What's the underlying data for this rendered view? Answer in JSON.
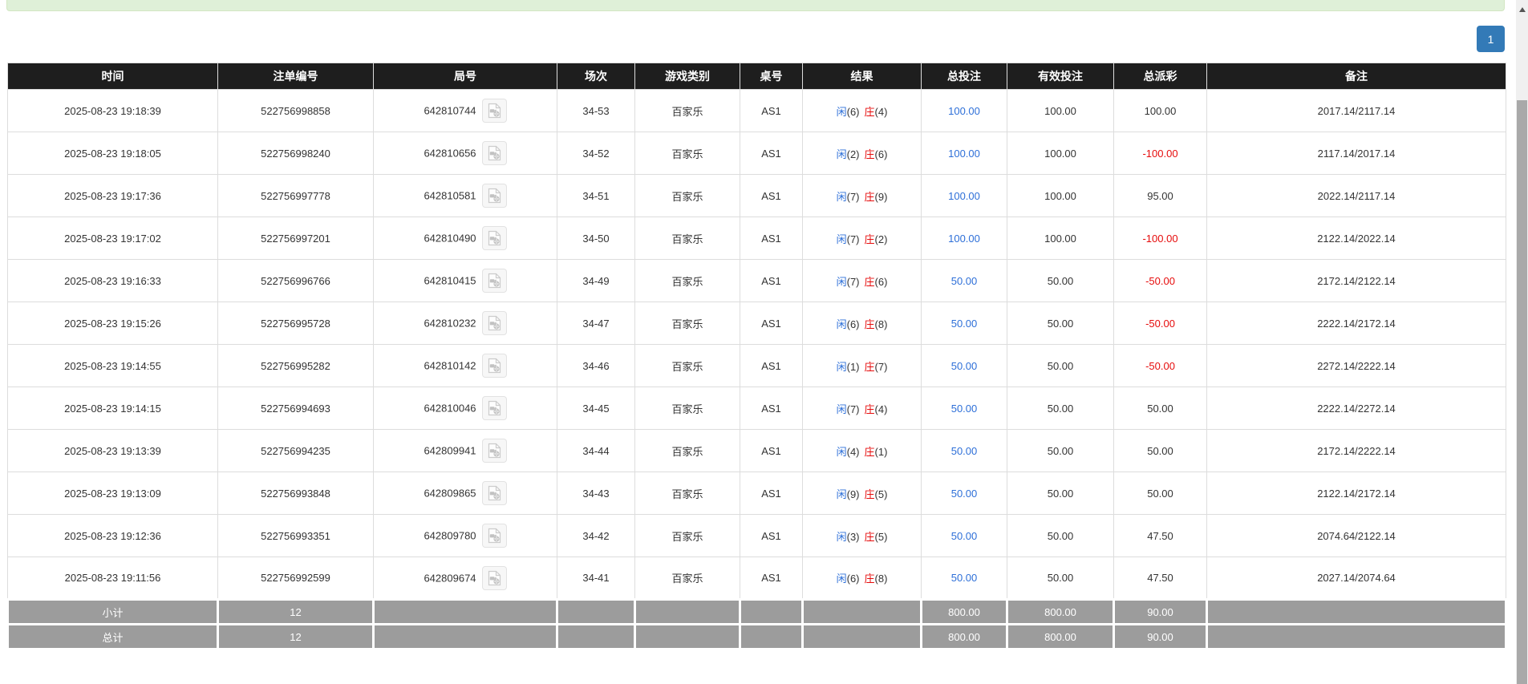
{
  "alert": {
    "text": ""
  },
  "pagination": {
    "active_page": "1"
  },
  "table": {
    "headers": [
      "时间",
      "注单编号",
      "局号",
      "场次",
      "游戏类别",
      "桌号",
      "结果",
      "总投注",
      "有效投注",
      "总派彩",
      "备注"
    ],
    "rows": [
      {
        "time": "2025-08-23 19:18:39",
        "bet_id": "522756998858",
        "round": "642810744",
        "session": "34-53",
        "game": "百家乐",
        "table": "AS1",
        "result_player": "闲",
        "result_player_num": "(6)",
        "result_banker": "庄",
        "result_banker_num": "(4)",
        "total_bet": "100.00",
        "valid_bet": "100.00",
        "payout": "100.00",
        "remark": "2017.14/2117.14"
      },
      {
        "time": "2025-08-23 19:18:05",
        "bet_id": "522756998240",
        "round": "642810656",
        "session": "34-52",
        "game": "百家乐",
        "table": "AS1",
        "result_player": "闲",
        "result_player_num": "(2)",
        "result_banker": "庄",
        "result_banker_num": "(6)",
        "total_bet": "100.00",
        "valid_bet": "100.00",
        "payout": "-100.00",
        "remark": "2117.14/2017.14"
      },
      {
        "time": "2025-08-23 19:17:36",
        "bet_id": "522756997778",
        "round": "642810581",
        "session": "34-51",
        "game": "百家乐",
        "table": "AS1",
        "result_player": "闲",
        "result_player_num": "(7)",
        "result_banker": "庄",
        "result_banker_num": "(9)",
        "total_bet": "100.00",
        "valid_bet": "100.00",
        "payout": "95.00",
        "remark": "2022.14/2117.14"
      },
      {
        "time": "2025-08-23 19:17:02",
        "bet_id": "522756997201",
        "round": "642810490",
        "session": "34-50",
        "game": "百家乐",
        "table": "AS1",
        "result_player": "闲",
        "result_player_num": "(7)",
        "result_banker": "庄",
        "result_banker_num": "(2)",
        "total_bet": "100.00",
        "valid_bet": "100.00",
        "payout": "-100.00",
        "remark": "2122.14/2022.14"
      },
      {
        "time": "2025-08-23 19:16:33",
        "bet_id": "522756996766",
        "round": "642810415",
        "session": "34-49",
        "game": "百家乐",
        "table": "AS1",
        "result_player": "闲",
        "result_player_num": "(7)",
        "result_banker": "庄",
        "result_banker_num": "(6)",
        "total_bet": "50.00",
        "valid_bet": "50.00",
        "payout": "-50.00",
        "remark": "2172.14/2122.14"
      },
      {
        "time": "2025-08-23 19:15:26",
        "bet_id": "522756995728",
        "round": "642810232",
        "session": "34-47",
        "game": "百家乐",
        "table": "AS1",
        "result_player": "闲",
        "result_player_num": "(6)",
        "result_banker": "庄",
        "result_banker_num": "(8)",
        "total_bet": "50.00",
        "valid_bet": "50.00",
        "payout": "-50.00",
        "remark": "2222.14/2172.14"
      },
      {
        "time": "2025-08-23 19:14:55",
        "bet_id": "522756995282",
        "round": "642810142",
        "session": "34-46",
        "game": "百家乐",
        "table": "AS1",
        "result_player": "闲",
        "result_player_num": "(1)",
        "result_banker": "庄",
        "result_banker_num": "(7)",
        "total_bet": "50.00",
        "valid_bet": "50.00",
        "payout": "-50.00",
        "remark": "2272.14/2222.14"
      },
      {
        "time": "2025-08-23 19:14:15",
        "bet_id": "522756994693",
        "round": "642810046",
        "session": "34-45",
        "game": "百家乐",
        "table": "AS1",
        "result_player": "闲",
        "result_player_num": "(7)",
        "result_banker": "庄",
        "result_banker_num": "(4)",
        "total_bet": "50.00",
        "valid_bet": "50.00",
        "payout": "50.00",
        "remark": "2222.14/2272.14"
      },
      {
        "time": "2025-08-23 19:13:39",
        "bet_id": "522756994235",
        "round": "642809941",
        "session": "34-44",
        "game": "百家乐",
        "table": "AS1",
        "result_player": "闲",
        "result_player_num": "(4)",
        "result_banker": "庄",
        "result_banker_num": "(1)",
        "total_bet": "50.00",
        "valid_bet": "50.00",
        "payout": "50.00",
        "remark": "2172.14/2222.14"
      },
      {
        "time": "2025-08-23 19:13:09",
        "bet_id": "522756993848",
        "round": "642809865",
        "session": "34-43",
        "game": "百家乐",
        "table": "AS1",
        "result_player": "闲",
        "result_player_num": "(9)",
        "result_banker": "庄",
        "result_banker_num": "(5)",
        "total_bet": "50.00",
        "valid_bet": "50.00",
        "payout": "50.00",
        "remark": "2122.14/2172.14"
      },
      {
        "time": "2025-08-23 19:12:36",
        "bet_id": "522756993351",
        "round": "642809780",
        "session": "34-42",
        "game": "百家乐",
        "table": "AS1",
        "result_player": "闲",
        "result_player_num": "(3)",
        "result_banker": "庄",
        "result_banker_num": "(5)",
        "total_bet": "50.00",
        "valid_bet": "50.00",
        "payout": "47.50",
        "remark": "2074.64/2122.14"
      },
      {
        "time": "2025-08-23 19:11:56",
        "bet_id": "522756992599",
        "round": "642809674",
        "session": "34-41",
        "game": "百家乐",
        "table": "AS1",
        "result_player": "闲",
        "result_player_num": "(6)",
        "result_banker": "庄",
        "result_banker_num": "(8)",
        "total_bet": "50.00",
        "valid_bet": "50.00",
        "payout": "47.50",
        "remark": "2027.14/2074.64"
      }
    ],
    "subtotal": {
      "label": "小计",
      "count": "12",
      "total_bet": "800.00",
      "valid_bet": "800.00",
      "payout": "90.00"
    },
    "grand_total": {
      "label": "总计",
      "count": "12",
      "total_bet": "800.00",
      "valid_bet": "800.00",
      "payout": "90.00"
    }
  },
  "icons": {
    "round_cell": "video-replay-icon",
    "scrollbar_top": "up-arrow-icon"
  },
  "colors": {
    "player-blue": "#2d6fd8",
    "banker-red": "#e60c0c",
    "negative-red": "#e60c0c",
    "header-bg": "#1e1e1e",
    "summary-bg": "#9c9c9c",
    "pagination-blue": "#337ab7",
    "alert-green": "#dff0d8"
  }
}
